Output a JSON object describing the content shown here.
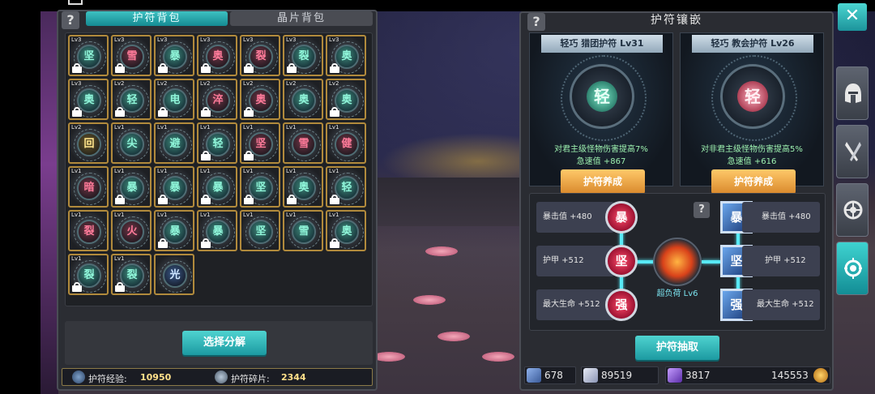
{
  "left_panel": {
    "help_label": "?",
    "tabs": [
      {
        "label": "护符背包",
        "active": true
      },
      {
        "label": "晶片背包",
        "active": false
      }
    ],
    "inventory": [
      {
        "lvl": "Lv3",
        "char": "坚",
        "color": "teal",
        "locked": true
      },
      {
        "lvl": "Lv3",
        "char": "雪",
        "color": "red",
        "locked": true
      },
      {
        "lvl": "Lv3",
        "char": "暴",
        "color": "teal",
        "locked": true
      },
      {
        "lvl": "Lv3",
        "char": "奥",
        "color": "red",
        "locked": true
      },
      {
        "lvl": "Lv3",
        "char": "裂",
        "color": "red",
        "locked": true
      },
      {
        "lvl": "Lv3",
        "char": "裂",
        "color": "teal",
        "locked": true
      },
      {
        "lvl": "Lv3",
        "char": "奥",
        "color": "teal",
        "locked": true
      },
      {
        "lvl": "Lv3",
        "char": "奥",
        "color": "teal",
        "locked": true
      },
      {
        "lvl": "Lv2",
        "char": "轻",
        "color": "teal",
        "locked": true
      },
      {
        "lvl": "Lv2",
        "char": "电",
        "color": "teal",
        "locked": true
      },
      {
        "lvl": "Lv2",
        "char": "淬",
        "color": "red",
        "locked": true
      },
      {
        "lvl": "Lv2",
        "char": "奥",
        "color": "red",
        "locked": true
      },
      {
        "lvl": "Lv2",
        "char": "奥",
        "color": "teal",
        "locked": false
      },
      {
        "lvl": "Lv2",
        "char": "奥",
        "color": "teal",
        "locked": true
      },
      {
        "lvl": "Lv2",
        "char": "回",
        "color": "gold",
        "locked": false
      },
      {
        "lvl": "Lv1",
        "char": "尖",
        "color": "teal",
        "locked": false
      },
      {
        "lvl": "Lv1",
        "char": "避",
        "color": "teal",
        "locked": false
      },
      {
        "lvl": "Lv1",
        "char": "轻",
        "color": "teal",
        "locked": true
      },
      {
        "lvl": "Lv1",
        "char": "坚",
        "color": "red",
        "locked": true
      },
      {
        "lvl": "Lv1",
        "char": "雪",
        "color": "red",
        "locked": false
      },
      {
        "lvl": "Lv1",
        "char": "健",
        "color": "red",
        "locked": false
      },
      {
        "lvl": "Lv1",
        "char": "暗",
        "color": "red",
        "locked": false
      },
      {
        "lvl": "Lv1",
        "char": "暴",
        "color": "teal",
        "locked": true
      },
      {
        "lvl": "Lv1",
        "char": "暴",
        "color": "teal",
        "locked": true
      },
      {
        "lvl": "Lv1",
        "char": "暴",
        "color": "teal",
        "locked": true
      },
      {
        "lvl": "Lv1",
        "char": "坚",
        "color": "teal",
        "locked": true
      },
      {
        "lvl": "Lv1",
        "char": "奥",
        "color": "teal",
        "locked": true
      },
      {
        "lvl": "Lv1",
        "char": "轻",
        "color": "teal",
        "locked": true
      },
      {
        "lvl": "Lv1",
        "char": "裂",
        "color": "red",
        "locked": false
      },
      {
        "lvl": "Lv1",
        "char": "火",
        "color": "red",
        "locked": false
      },
      {
        "lvl": "Lv1",
        "char": "暴",
        "color": "teal",
        "locked": true
      },
      {
        "lvl": "Lv1",
        "char": "暴",
        "color": "teal",
        "locked": true
      },
      {
        "lvl": "Lv1",
        "char": "坚",
        "color": "teal",
        "locked": false
      },
      {
        "lvl": "Lv1",
        "char": "雪",
        "color": "teal",
        "locked": false
      },
      {
        "lvl": "Lv1",
        "char": "奥",
        "color": "teal",
        "locked": true
      },
      {
        "lvl": "Lv1",
        "char": "裂",
        "color": "teal",
        "locked": true
      },
      {
        "lvl": "Lv1",
        "char": "裂",
        "color": "teal",
        "locked": true
      },
      {
        "lvl": "",
        "char": "光",
        "color": "blue",
        "locked": false
      }
    ],
    "decompose_button": "选择分解",
    "exp_label": "护符经验:",
    "exp_value": "10950",
    "shard_label": "护符碎片:",
    "shard_value": "2344"
  },
  "right_panel": {
    "title": "护符镶嵌",
    "help_label": "?",
    "cards": [
      {
        "title": "轻巧 猎团护符 Lv31",
        "core_char": "轻",
        "desc": "对君主级怪物伤害提高7%",
        "stat": "急速值 +867",
        "button": "护符养成"
      },
      {
        "title": "轻巧 教会护符 Lv26",
        "core_char": "轻",
        "desc": "对非君主级怪物伤害提高5%",
        "stat": "急速值 +616",
        "button": "护符养成"
      }
    ],
    "left_stats": [
      "暴击值 +480",
      "护甲 +512",
      "最大生命 +512"
    ],
    "left_gems": [
      "暴",
      "坚",
      "强"
    ],
    "right_stats": [
      "暴击值 +480",
      "护甲 +512",
      "最大生命 +512"
    ],
    "right_gems": [
      "暴",
      "坚",
      "强"
    ],
    "center_label": "超负荷 Lv6",
    "extract_button": "护符抽取",
    "resources": [
      {
        "name": "wand-icon",
        "value": "678",
        "color": "#6c8cc8"
      },
      {
        "name": "potion-icon",
        "value": "89519",
        "color": "#c8d0e8"
      },
      {
        "name": "crystal-icon",
        "value": "3817",
        "color": "#9b6ee8"
      },
      {
        "name": "coin-icon",
        "value": "145553",
        "color": "#e6a12c"
      }
    ]
  },
  "close_label": "✕",
  "side_tabs": [
    {
      "name": "helmet-icon",
      "active": false
    },
    {
      "name": "blades-icon",
      "active": false
    },
    {
      "name": "shield-wheel-icon",
      "active": false
    },
    {
      "name": "amulet-icon",
      "active": true
    }
  ]
}
